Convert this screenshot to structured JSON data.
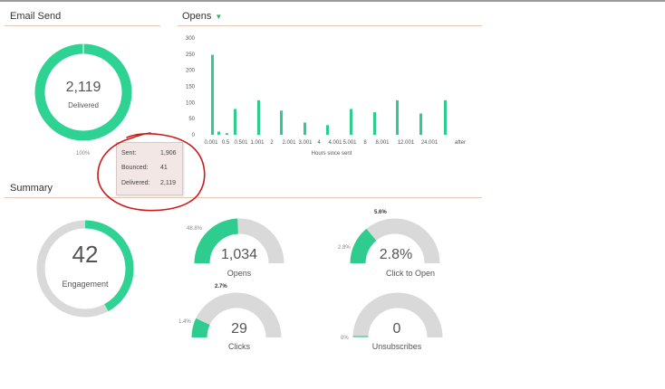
{
  "email_send": {
    "title": "Email Send",
    "donut_value": "2,119",
    "donut_label": "Delivered",
    "percent": "100%"
  },
  "tooltip": {
    "rows": [
      {
        "label": "Sent:",
        "value": "1,906"
      },
      {
        "label": "Bounced:",
        "value": "41"
      },
      {
        "label": "Delivered:",
        "value": "2,119"
      }
    ]
  },
  "opens": {
    "title": "Opens",
    "xlabel": "Hours since sent"
  },
  "chart_data": {
    "type": "bar",
    "ylim": [
      0,
      300
    ],
    "yticks": [
      0,
      50,
      100,
      150,
      200,
      250,
      300
    ],
    "tick_labels": [
      "0.001",
      "0.5",
      "0.501",
      "1.001",
      "2",
      "2.001",
      "3.001",
      "4",
      "4.001",
      "5.001",
      "8",
      "8.001",
      "12.001",
      "24.001",
      "after"
    ],
    "values": [
      248,
      10,
      5,
      80,
      107,
      75,
      38,
      30,
      80,
      70,
      107,
      66,
      107
    ],
    "xlabel": "Hours since sent",
    "color": "#2ecc8f",
    "grid": false
  },
  "summary": {
    "title": "Summary",
    "engagement": {
      "value": "42",
      "label": "Engagement",
      "fraction": 0.42
    },
    "opens": {
      "value": "1,034",
      "label": "Opens",
      "left_pct": "48.8%",
      "fraction": 0.488
    },
    "click_to_open": {
      "value": "2.8%",
      "label": "Click to Open",
      "left_pct": "2.8%",
      "top_pct": "5.6%",
      "fraction": 0.28
    },
    "clicks": {
      "value": "29",
      "label": "Clicks",
      "left_pct": "1.4%",
      "top_pct": "2.7%",
      "fraction": 0.14
    },
    "unsubscribes": {
      "value": "0",
      "label": "Unsubscribes",
      "left_pct": "0%",
      "fraction": 0.0
    }
  },
  "colors": {
    "accent": "#2ecc8f",
    "gauge_bg": "#d9d9d9",
    "annotation": "#cc1a1a"
  }
}
